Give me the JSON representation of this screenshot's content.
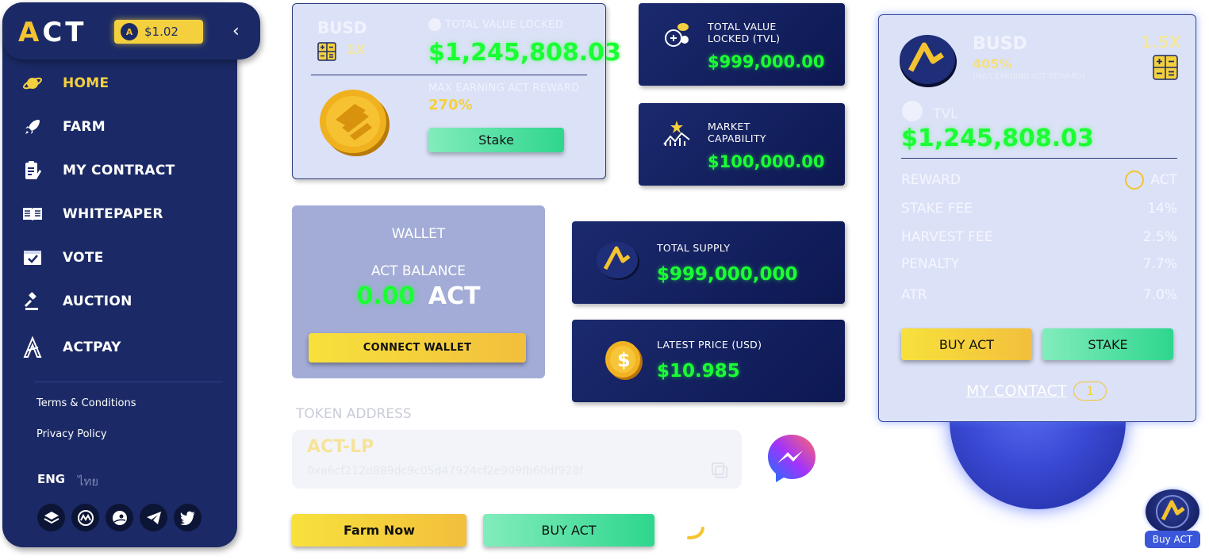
{
  "sidebar": {
    "logo_prefix": "A",
    "logo_rest": "CT",
    "price": "$1.02",
    "collapse_icon": "‹",
    "nav": [
      {
        "label": "HOME",
        "icon": "planet-icon"
      },
      {
        "label": "FARM",
        "icon": "rocket-icon"
      },
      {
        "label": "MY CONTRACT",
        "icon": "contract-icon"
      },
      {
        "label": "WHITEPAPER",
        "icon": "book-icon"
      },
      {
        "label": "VOTE",
        "icon": "vote-box-icon"
      },
      {
        "label": "AUCTION",
        "icon": "gavel-icon"
      },
      {
        "label": "ACTPAY",
        "icon": "actpay-icon"
      }
    ],
    "links": [
      "Terms & Conditions",
      "Privacy Policy"
    ],
    "languages": [
      "ENG",
      "ไทย"
    ],
    "socials": [
      "layers-icon",
      "coinmarketcap-icon",
      "coingecko-icon",
      "telegram-icon",
      "twitter-icon"
    ]
  },
  "busd_card": {
    "title": "BUSD",
    "multiplier": "1X",
    "tvl_label": "TOTAL VALUE LOCKED",
    "tvl_value": "$1,245,808.03",
    "max_label": "MAX EARNING ACT REWARD",
    "max_value": "270%",
    "stake_label": "Stake"
  },
  "stats": [
    {
      "title": "TOTAL VALUE\nLOCKED (TVL)",
      "value": "$999,000.00"
    },
    {
      "title": "MARKET\nCAPABILITY",
      "value": "$100,000.00"
    },
    {
      "title": "TOTAL SUPPLY",
      "value": "$999,000,000"
    },
    {
      "title": "LATEST PRICE (USD)",
      "value": "$10.985"
    }
  ],
  "wallet": {
    "title": "WALLET",
    "balance_label": "ACT BALANCE",
    "balance_value": "0.00",
    "balance_unit": "ACT",
    "connect_label": "CONNECT WALLET"
  },
  "token": {
    "label": "TOKEN ADDRESS",
    "name": "ACT-LP",
    "address": "0xa6cf212d889dc9c05d47924cf2e909fb60df928f"
  },
  "actions": {
    "farm_now": "Farm Now",
    "buy_act": "BUY ACT"
  },
  "pool": {
    "title": "BUSD",
    "apr": "405%",
    "apr_note": "(MAX EARNING ACT REWARD)",
    "multiplier": "1.5X",
    "tvl_label": "TVL",
    "tvl_value": "$1,245,808.03",
    "rows": [
      {
        "label": "REWARD",
        "value": "ACT"
      },
      {
        "label": "STAKE FEE",
        "value": "14%"
      },
      {
        "label": "HARVEST FEE",
        "value": "2.5%"
      },
      {
        "label": "PENALTY",
        "value": "7.7%"
      },
      {
        "label": "ATR",
        "value": "7.0%"
      }
    ],
    "buy_label": "BUY ACT",
    "stake_label": "STAKE",
    "contact_label": "MY CONTACT",
    "contact_count": "1"
  },
  "floating": {
    "buy_label": "Buy ACT"
  },
  "colors": {
    "navy": "#1b2a66",
    "green": "#19ff33",
    "yellow": "#f4d03f"
  }
}
